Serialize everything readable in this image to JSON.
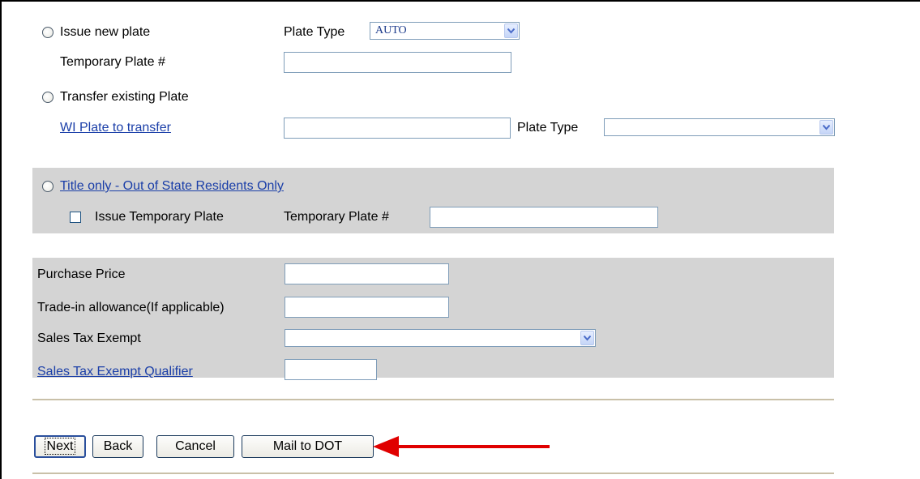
{
  "plate_options": {
    "issue_new_plate_label": "Issue new plate",
    "plate_type_label": "Plate Type",
    "plate_type_value": "AUTO",
    "temporary_plate_label": "Temporary Plate #",
    "transfer_existing_label": "Transfer existing Plate",
    "wi_plate_link": "WI Plate to transfer",
    "transfer_plate_type_label": "Plate Type",
    "transfer_plate_type_value": ""
  },
  "title_only": {
    "link": "Title only - Out of State Residents Only",
    "issue_temp_label": "Issue Temporary Plate",
    "temp_plate_label": "Temporary Plate #"
  },
  "sales": {
    "purchase_price_label": "Purchase Price",
    "trade_in_label": "Trade-in allowance(If applicable)",
    "sales_tax_exempt_label": "Sales Tax Exempt",
    "sales_tax_exempt_value": "",
    "exempt_qualifier_link": "Sales Tax Exempt Qualifier"
  },
  "buttons": {
    "next": "Next",
    "back": "Back",
    "cancel": "Cancel",
    "mail": "Mail to DOT"
  },
  "annotation": {
    "arrow_color": "#e00000"
  }
}
